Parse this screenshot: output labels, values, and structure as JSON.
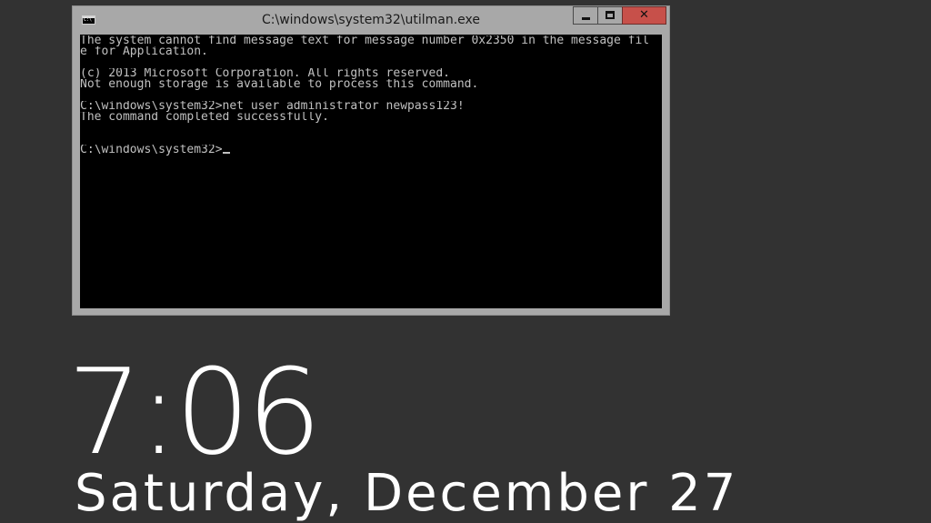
{
  "window": {
    "title": "C:\\windows\\system32\\utilman.exe",
    "icon": "console-app-icon",
    "buttons": {
      "minimize": "minimize-icon",
      "maximize": "maximize-icon",
      "close": "✕"
    }
  },
  "console": {
    "lines": [
      "The system cannot find message text for message number 0x2350 in the message fil",
      "e for Application.",
      "",
      "(c) 2013 Microsoft Corporation. All rights reserved.",
      "Not enough storage is available to process this command.",
      "",
      "C:\\windows\\system32>net user administrator newpass123!",
      "The command completed successfully.",
      "",
      "",
      "C:\\windows\\system32>"
    ]
  },
  "lockscreen": {
    "time": "7:06",
    "date": "Saturday, December 27"
  },
  "colors": {
    "lockscreen_bg": "#323232",
    "window_frame": "#a8a8a8",
    "close_button": "#c7504a",
    "console_bg": "#000000",
    "console_text": "#c0c0c0"
  }
}
